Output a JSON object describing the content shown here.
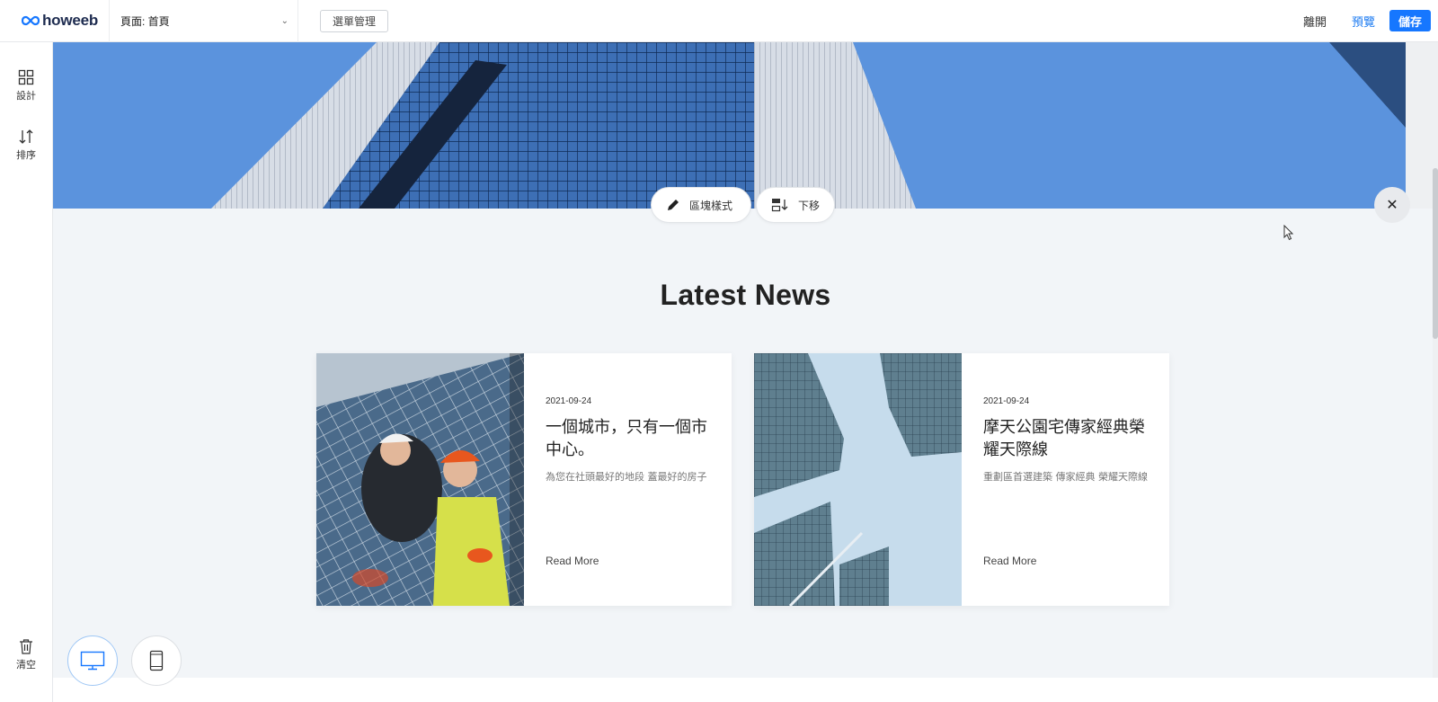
{
  "topbar": {
    "logo_text": "howeeb",
    "page_select_label": "頁面: 首頁",
    "menu_manage_label": "選單管理",
    "leave_label": "離開",
    "preview_label": "預覽",
    "save_label": "儲存"
  },
  "sidebar": {
    "design_label": "設計",
    "sort_label": "排序",
    "clear_label": "清空"
  },
  "block_toolbar": {
    "style_label": "區塊樣式",
    "move_down_label": "下移",
    "close_symbol": "✕"
  },
  "news": {
    "title": "Latest News",
    "cards": [
      {
        "date": "2021-09-24",
        "title": "一個城市，只有一個市中心。",
        "desc": "為您在社頭最好的地段 蓋最好的房子",
        "more": "Read More"
      },
      {
        "date": "2021-09-24",
        "title": "摩天公園宅傳家經典榮耀天際線",
        "desc": "重劃區首選建築 傳家經典 榮耀天際線",
        "more": "Read More"
      }
    ]
  },
  "colors": {
    "accent": "#1677ff",
    "preview_link": "#1e7cf2",
    "canvas_bg": "#f2f5f8"
  },
  "icons": {
    "logo": "infinity-icon",
    "design": "grid-icon",
    "sort": "sort-arrows-icon",
    "clear": "trash-icon",
    "style": "pencil-icon",
    "move_down": "move-down-icon",
    "close": "close-icon",
    "desktop": "desktop-icon",
    "mobile": "mobile-icon"
  }
}
